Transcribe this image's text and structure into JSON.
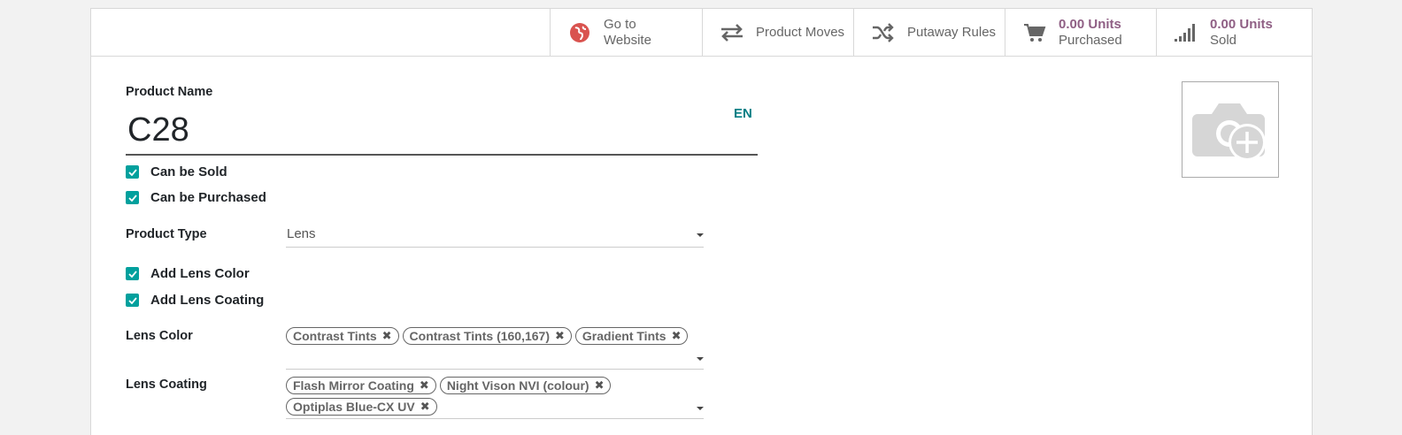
{
  "smart_buttons": [
    {
      "icon": "globe-icon",
      "line1": "Go to",
      "line2": "Website"
    },
    {
      "icon": "exchange-arrows-icon",
      "line1": "Product Moves",
      "line2": ""
    },
    {
      "icon": "shuffle-icon",
      "line1": "Putaway Rules",
      "line2": ""
    },
    {
      "icon": "shopping-cart-icon",
      "value": "0.00 Units",
      "label": "Purchased"
    },
    {
      "icon": "signal-bars-icon",
      "value": "0.00 Units",
      "label": "Sold"
    }
  ],
  "form": {
    "product_name_label": "Product Name",
    "product_name_value": "C28",
    "lang_button": "EN",
    "can_be_sold_label": "Can be Sold",
    "can_be_purchased_label": "Can be Purchased",
    "product_type_label": "Product Type",
    "product_type_value": "Lens",
    "add_lens_color_label": "Add Lens Color",
    "add_lens_coating_label": "Add Lens Coating",
    "lens_color_label": "Lens Color",
    "lens_color_tags": [
      "Contrast Tints",
      "Contrast Tints (160,167)",
      "Gradient Tints"
    ],
    "lens_coating_label": "Lens Coating",
    "lens_coating_tags": [
      "Flash Mirror Coating",
      "Night Vison NVI (colour)",
      "Optiplas Blue-CX UV"
    ],
    "tag_remove_glyph": "✖"
  },
  "colors": {
    "accent": "#01a09d",
    "stat_value": "#8f5f84",
    "lang": "#017e84",
    "globe": "#d9534f"
  }
}
